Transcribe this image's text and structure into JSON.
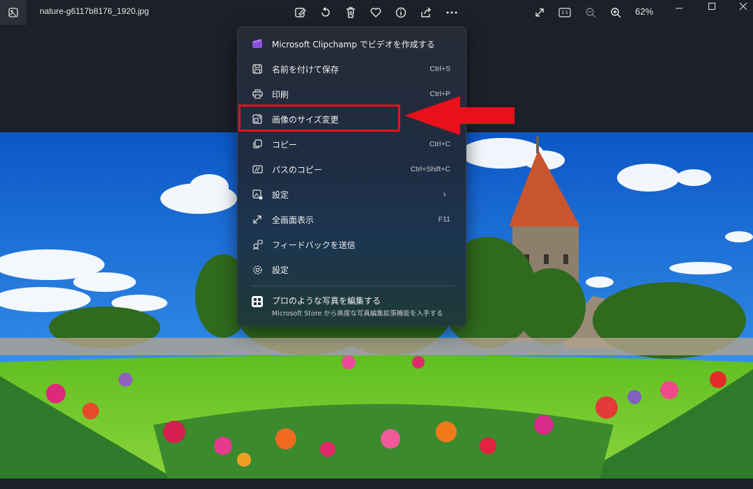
{
  "window": {
    "filename": "nature-g6117b8176_1920.jpg",
    "zoom": "62%"
  },
  "toolbar": {
    "icons": [
      "edit-icon",
      "rotate-icon",
      "delete-icon",
      "favorite-icon",
      "info-icon",
      "share-icon",
      "more-icon"
    ],
    "right_icons": [
      "fullscreen-icon",
      "actual-size-icon",
      "zoom-out-icon",
      "zoom-in-icon"
    ],
    "actual_size_label": "1:1"
  },
  "menu": {
    "items": [
      {
        "label": "Microsoft Clipchamp でビデオを作成する",
        "shortcut": "",
        "icon": "clipchamp-icon"
      },
      {
        "label": "名前を付けて保存",
        "shortcut": "Ctrl+S",
        "icon": "save-icon"
      },
      {
        "label": "印刷",
        "shortcut": "Ctrl+P",
        "icon": "print-icon"
      },
      {
        "label": "画像のサイズ変更",
        "shortcut": "",
        "icon": "resize-icon"
      },
      {
        "label": "コピー",
        "shortcut": "Ctrl+C",
        "icon": "copy-icon"
      },
      {
        "label": "パスのコピー",
        "shortcut": "Ctrl+Shift+C",
        "icon": "copy-path-icon"
      },
      {
        "label": "設定",
        "shortcut": "",
        "icon": "set-as-icon"
      },
      {
        "label": "全画面表示",
        "shortcut": "F11",
        "icon": "fullscreen-icon"
      },
      {
        "label": "フィードバックを送信",
        "shortcut": "",
        "icon": "feedback-icon"
      },
      {
        "label": "設定",
        "shortcut": "",
        "icon": "gear-icon"
      }
    ],
    "promo": {
      "title": "プロのような写真を編集する",
      "subtitle": "Microsoft Store から高度な写真編集拡張機能を入手する"
    }
  },
  "colors": {
    "annotation": "#e8101a",
    "background": "#1c2028"
  }
}
